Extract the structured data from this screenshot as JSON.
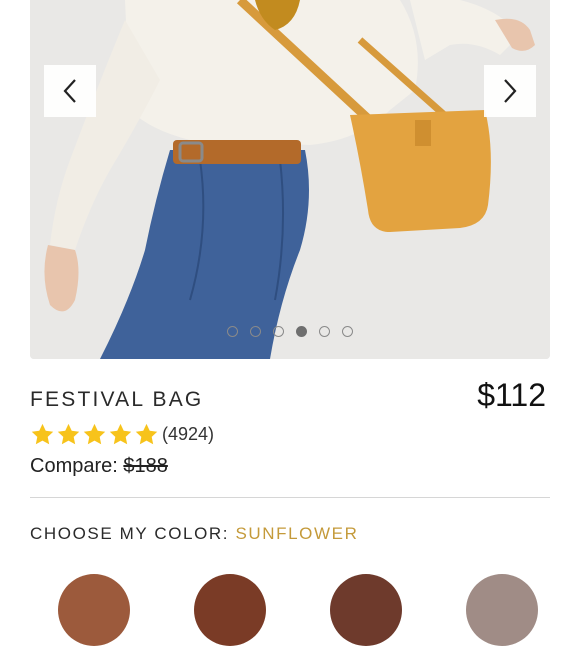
{
  "gallery": {
    "slide_count": 6,
    "active_index": 3,
    "prev_icon": "chevron-left-icon",
    "next_icon": "chevron-right-icon"
  },
  "product": {
    "title": "FESTIVAL BAG",
    "price": "$112",
    "rating": 5,
    "review_count": "(4924)",
    "compare_label": "Compare:",
    "compare_price": "$188"
  },
  "color_picker": {
    "label": "CHOOSE MY COLOR:",
    "selected": "SUNFLOWER"
  },
  "colors": {
    "star": "#f7c31b",
    "accent": "#c49a3a",
    "swatches": [
      "#9c5a3c",
      "#7a3b26",
      "#6e3a2c",
      "#a08c86"
    ]
  }
}
